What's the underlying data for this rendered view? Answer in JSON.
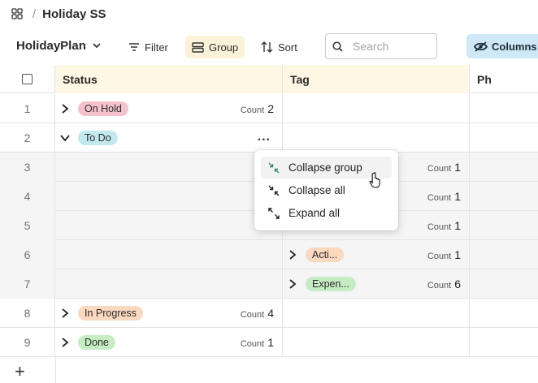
{
  "breadcrumb": {
    "title": "Holiday SS",
    "separator": "/"
  },
  "toolbar": {
    "view_name": "HolidayPlan",
    "filter_label": "Filter",
    "group_label": "Group",
    "sort_label": "Sort",
    "search_placeholder": "Search",
    "columns_label": "Columns"
  },
  "grid": {
    "columns": [
      "Status",
      "Tag",
      "Ph"
    ],
    "rows": [
      {
        "num": "1",
        "status": "On Hold",
        "status_color": "#f5c1cc",
        "count_label": "Count",
        "count": "2"
      },
      {
        "num": "2",
        "status": "To Do",
        "status_color": "#c1e9ee",
        "more": "..."
      },
      {
        "num": "3",
        "count_label": "Count",
        "count": "1"
      },
      {
        "num": "4",
        "count_label": "Count",
        "count": "1"
      },
      {
        "num": "5",
        "count_label": "Count",
        "count": "1"
      },
      {
        "num": "6",
        "tag": "Acti...",
        "tag_color": "#fbd9bf",
        "count_label": "Count",
        "count": "1"
      },
      {
        "num": "7",
        "tag": "Expen...",
        "tag_color": "#c6ecc4",
        "count_label": "Count",
        "count": "6"
      },
      {
        "num": "8",
        "status": "In Progress",
        "status_color": "#fbd9bf",
        "count_label": "Count",
        "count": "4"
      },
      {
        "num": "9",
        "status": "Done",
        "status_color": "#c6ecc4",
        "count_label": "Count",
        "count": "1"
      }
    ],
    "add_symbol": "+"
  },
  "context_menu": {
    "items": [
      "Collapse group",
      "Collapse all",
      "Expand all"
    ]
  },
  "colors": {
    "accent_group": "#fbf3d9",
    "accent_columns": "#cfe8f7",
    "header_bg": "#fdf7e3"
  }
}
